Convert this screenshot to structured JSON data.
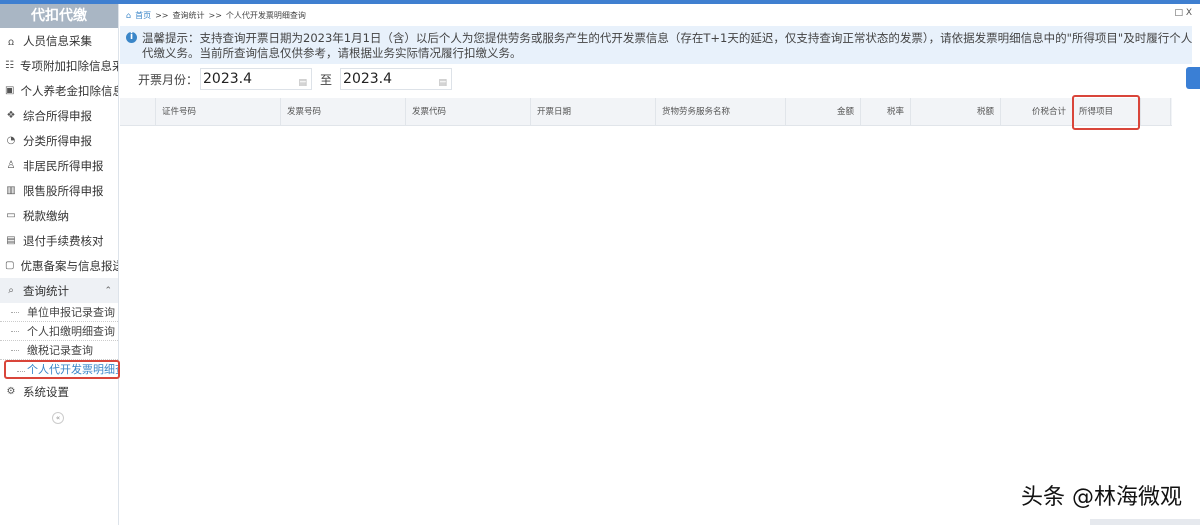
{
  "sidebar": {
    "title": "代扣代缴",
    "items": [
      {
        "label": "人员信息采集",
        "icon": "person-icon"
      },
      {
        "label": "专项附加扣除信息采集",
        "icon": "list-icon"
      },
      {
        "label": "个人养老金扣除信息",
        "icon": "document-icon"
      },
      {
        "label": "综合所得申报",
        "icon": "layers-icon"
      },
      {
        "label": "分类所得申报",
        "icon": "pie-icon"
      },
      {
        "label": "非居民所得申报",
        "icon": "user-icon"
      },
      {
        "label": "限售股所得申报",
        "icon": "bar-chart-icon"
      },
      {
        "label": "税款缴纳",
        "icon": "folder-icon"
      },
      {
        "label": "退付手续费核对",
        "icon": "receipt-icon"
      },
      {
        "label": "优惠备案与信息报送",
        "icon": "clipboard-icon"
      },
      {
        "label": "查询统计",
        "icon": "search-list-icon"
      }
    ],
    "sub_items": [
      "单位申报记录查询",
      "个人扣缴明细查询",
      "缴税记录查询",
      "个人代开发票明细查询"
    ],
    "settings": "系统设置",
    "collapse": "«"
  },
  "breadcrumb": {
    "home": "首页",
    "sep": ">>",
    "level1": "查询统计",
    "level2": "个人代开发票明细查询"
  },
  "window_controls": "□ X",
  "tip": {
    "icon": "i",
    "line1": "温馨提示：支持查询开票日期为2023年1月1日（含）以后个人为您提供劳务或服务产生的代开发票信息（存在T+1天的延迟，仅支持查询正常状态的发票），请依据发票明细信息中的\"所得项目\"及时履行个人所得税代扣",
    "line2": "代缴义务。当前所查询信息仅供参考，请根据业务实际情况履行扣缴义务。"
  },
  "filter": {
    "label": "开票月份：",
    "from": "2023.4",
    "to_label": "至",
    "to": "2023.4"
  },
  "table": {
    "columns": [
      "",
      "证件号码",
      "发票号码",
      "发票代码",
      "开票日期",
      "货物劳务服务名称",
      "金额",
      "税率",
      "税额",
      "价税合计",
      "所得项目",
      ""
    ]
  },
  "watermark": "头条 @林海微观"
}
